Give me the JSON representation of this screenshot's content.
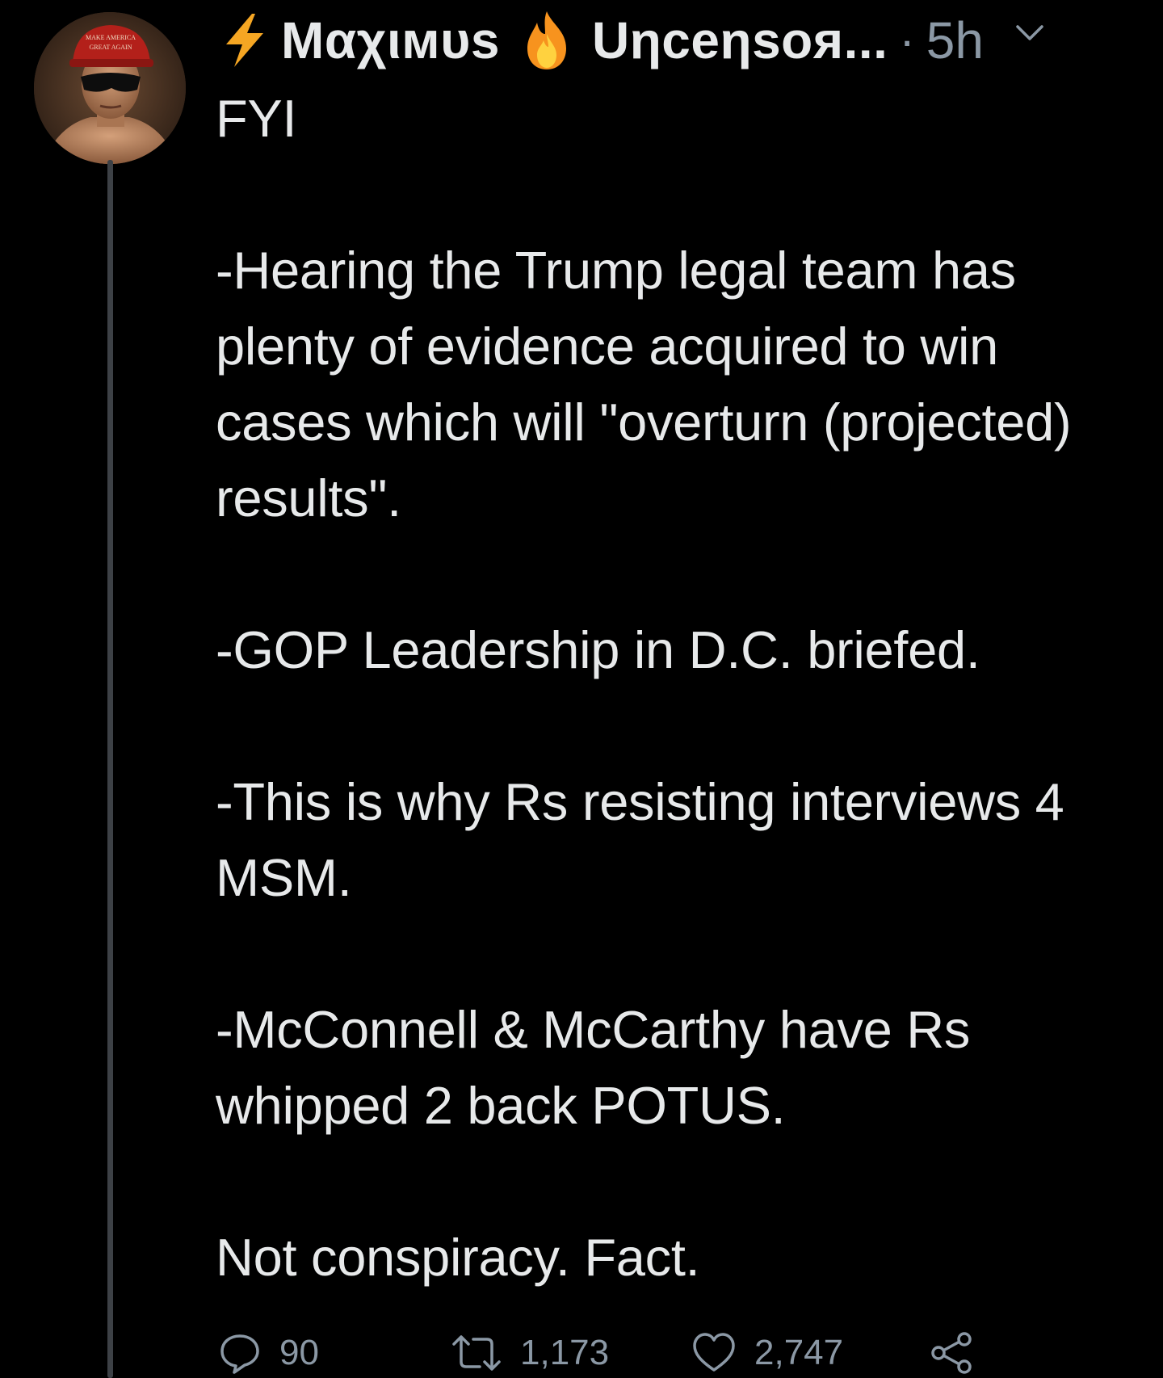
{
  "tweet": {
    "author_name_left": "Μαχιмυs",
    "author_name_right": "Uηceηsoя...",
    "separator": "·",
    "time": "5h",
    "text": "FYI\n\n-Hearing the Trump legal team has plenty of evidence acquired to win cases which will \"overturn (projected) results\".\n\n-GOP Leadership in D.C. briefed.\n\n-This is why Rs resisting interviews 4 MSM.\n\n-McConnell & McCarthy have Rs whipped 2 back POTUS.\n\nNot conspiracy. Fact.",
    "avatar_hat_text_1": "MAKE AMERICA",
    "avatar_hat_text_2": "GREAT AGAIN"
  },
  "actions": {
    "reply_count": "90",
    "retweet_count": "1,173",
    "like_count": "2,747"
  },
  "icons": {
    "bolt": "lightning-bolt-icon",
    "fire": "fire-emoji-icon",
    "caret": "chevron-down-icon",
    "reply": "reply-bubble-icon",
    "retweet": "retweet-icon",
    "like": "heart-icon",
    "share": "share-icon"
  },
  "colors": {
    "background": "#000000",
    "text": "#e7e9ea",
    "secondary": "#8b98a5",
    "bolt": "#f5a623",
    "thread_line": "#3d4146"
  }
}
